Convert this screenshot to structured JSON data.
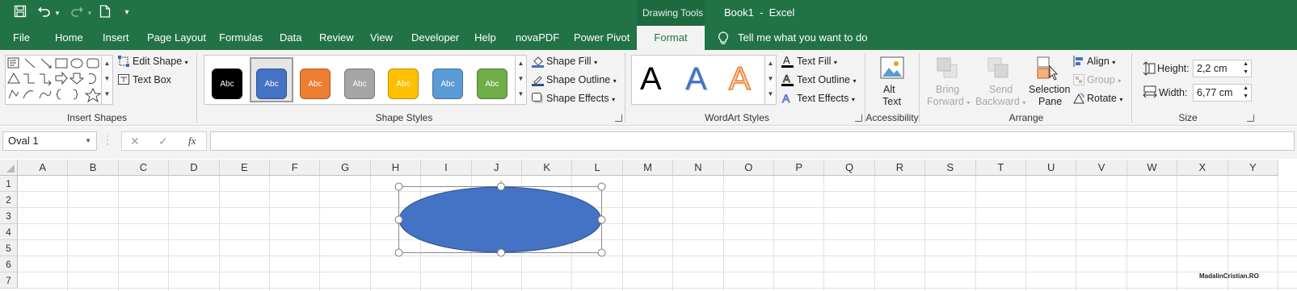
{
  "title_bar": {
    "context_title": "Drawing Tools",
    "doc_title": "Book1  -  Excel",
    "qat": {
      "save": "save-icon",
      "undo": "undo-icon",
      "redo": "redo-icon",
      "new": "new-document-icon",
      "customize": "▾"
    }
  },
  "tabs": [
    "File",
    "Home",
    "Insert",
    "Page Layout",
    "Formulas",
    "Data",
    "Review",
    "View",
    "Developer",
    "Help",
    "novaPDF",
    "Power Pivot",
    "Format"
  ],
  "tell_me": "Tell me what you want to do",
  "ribbon": {
    "insert_shapes": {
      "label": "Insert Shapes",
      "edit_shape": "Edit Shape",
      "text_box": "Text Box"
    },
    "shape_styles": {
      "label": "Shape Styles",
      "swatch_text": "Abc",
      "swatch_colors": [
        "#000000",
        "#4472c4",
        "#ed7d31",
        "#a5a5a5",
        "#ffc000",
        "#5b9bd5",
        "#70ad47"
      ],
      "shape_fill": "Shape Fill",
      "shape_outline": "Shape Outline",
      "shape_effects": "Shape Effects"
    },
    "wordart": {
      "label": "WordArt Styles",
      "letters": [
        "A",
        "A",
        "A"
      ],
      "text_fill": "Text Fill",
      "text_outline": "Text Outline",
      "text_effects": "Text Effects"
    },
    "accessibility": {
      "label": "Accessibility",
      "alt_text_1": "Alt",
      "alt_text_2": "Text"
    },
    "arrange": {
      "label": "Arrange",
      "bring_forward_1": "Bring",
      "bring_forward_2": "Forward",
      "send_backward_1": "Send",
      "send_backward_2": "Backward",
      "selection_pane_1": "Selection",
      "selection_pane_2": "Pane",
      "align": "Align",
      "group": "Group",
      "rotate": "Rotate"
    },
    "size": {
      "label": "Size",
      "height_label": "Height:",
      "height_value": "2,2 cm",
      "width_label": "Width:",
      "width_value": "6,77 cm"
    }
  },
  "formula_bar": {
    "name_box": "Oval 1",
    "cancel": "✕",
    "enter": "✓",
    "fx": "fx",
    "formula": ""
  },
  "grid": {
    "columns": [
      "A",
      "B",
      "C",
      "D",
      "E",
      "F",
      "G",
      "H",
      "I",
      "J",
      "K",
      "L",
      "M",
      "N",
      "O",
      "P",
      "Q",
      "R",
      "S",
      "T",
      "U",
      "V",
      "W",
      "X",
      "Y"
    ],
    "rows": [
      "1",
      "2",
      "3",
      "4",
      "5",
      "6",
      "7"
    ]
  },
  "shape": {
    "name": "Oval 1",
    "fill": "#4472c4",
    "outline": "#2f528f"
  },
  "watermark": "MadalinCristian.RO",
  "colors": {
    "accent": "#217346"
  }
}
